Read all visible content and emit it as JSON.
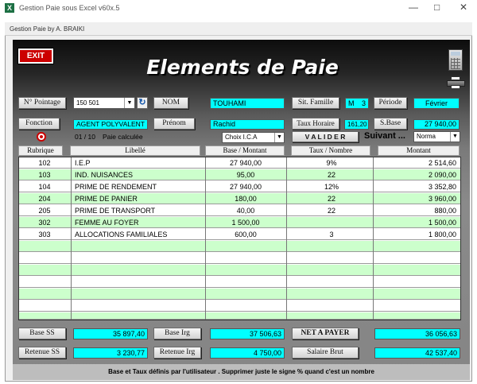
{
  "window": {
    "title": "Gestion Paie sous Excel v60x.5",
    "inner_title": "Gestion Paie by A. BRAIKI"
  },
  "app": {
    "exit_label": "EXIT",
    "title": "Elements de Paie"
  },
  "form": {
    "pointage_label": "N° Pointage",
    "pointage_value": "150 501",
    "nom_label": "NOM",
    "nom_value": "TOUHAMI",
    "sit_famille_label": "Sit. Famille",
    "sit_famille_value": "M",
    "sit_famille_count": "3",
    "periode_label": "Période",
    "periode_value": "Février",
    "fonction_label": "Fonction",
    "fonction_value": "AGENT POLYVALENT",
    "prenom_label": "Prénom",
    "prenom_value": "Rachid",
    "taux_horaire_label": "Taux Horaire",
    "taux_horaire_value": "161,20",
    "sbase_label": "S.Base",
    "sbase_value": "27 940,00",
    "paie_count": "01 / 10",
    "paie_status": "Paie calculée",
    "choix_value": "Choix I.C.A",
    "valider_label": "V A L I D E R",
    "suivant_label": "Suivant ...",
    "norma_value": "Norma"
  },
  "table": {
    "headers": [
      "Rubrique",
      "Libellé",
      "Base / Montant",
      "Taux / Nombre",
      "Montant"
    ],
    "rows": [
      {
        "rubrique": "102",
        "libelle": "I.E.P",
        "base": "27 940,00",
        "taux": "9%",
        "montant": "2 514,60"
      },
      {
        "rubrique": "103",
        "libelle": "IND. NUISANCES",
        "base": "95,00",
        "taux": "22",
        "montant": "2 090,00"
      },
      {
        "rubrique": "104",
        "libelle": "PRIME DE RENDEMENT",
        "base": "27 940,00",
        "taux": "12%",
        "montant": "3 352,80"
      },
      {
        "rubrique": "204",
        "libelle": "PRIME DE PANIER",
        "base": "180,00",
        "taux": "22",
        "montant": "3 960,00"
      },
      {
        "rubrique": "205",
        "libelle": "PRIME DE TRANSPORT",
        "base": "40,00",
        "taux": "22",
        "montant": "880,00"
      },
      {
        "rubrique": "302",
        "libelle": "FEMME AU FOYER",
        "base": "1 500,00",
        "taux": "",
        "montant": "1 500,00"
      },
      {
        "rubrique": "303",
        "libelle": "ALLOCATIONS FAMILIALES",
        "base": "600,00",
        "taux": "3",
        "montant": "1 800,00"
      }
    ]
  },
  "totals": {
    "base_ss_label": "Base SS",
    "base_ss_value": "35 897,40",
    "base_irg_label": "Base Irg",
    "base_irg_value": "37 506,63",
    "net_label": "NET A PAYER",
    "net_value": "36 056,63",
    "retenue_ss_label": "Retenue SS",
    "retenue_ss_value": "3 230,77",
    "retenue_irg_label": "Retenue Irg",
    "retenue_irg_value": "4 750,00",
    "salaire_brut_label": "Salaire Brut",
    "salaire_brut_value": "42 537,40"
  },
  "footer_note": "Base et Taux définis par l'utilisateur . Supprimer juste le signe  %   quand c'est un nombre",
  "colors": {
    "accent_cyan": "#00ffff",
    "row_green": "#ccffcc",
    "exit_red": "#cc0000"
  }
}
